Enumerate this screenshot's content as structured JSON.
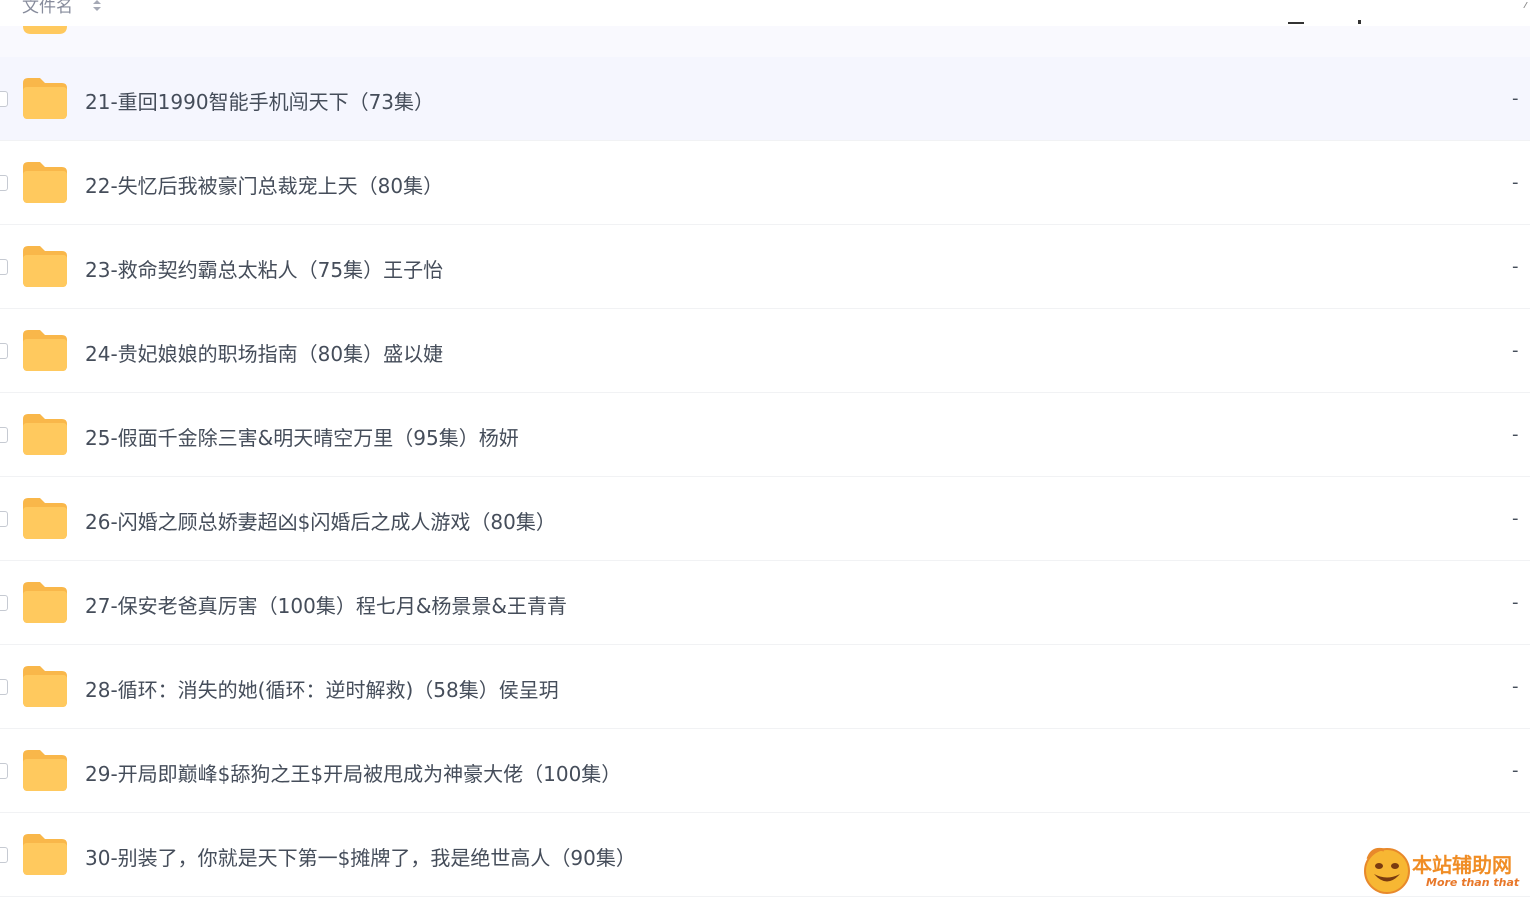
{
  "header": {
    "filename_label": "文件名"
  },
  "rows": [
    {
      "name": "",
      "size": ""
    },
    {
      "name": "21-重回1990智能手机闯天下（73集）",
      "size": "-"
    },
    {
      "name": "22-失忆后我被豪门总裁宠上天（80集）",
      "size": "-"
    },
    {
      "name": "23-救命契约霸总太粘人（75集）王子怡",
      "size": "-"
    },
    {
      "name": "24-贵妃娘娘的职场指南（80集）盛以婕",
      "size": "-"
    },
    {
      "name": "25-假面千金除三害&明天晴空万里（95集）杨妍",
      "size": "-"
    },
    {
      "name": "26-闪婚之顾总娇妻超凶$闪婚后之成人游戏（80集）",
      "size": "-"
    },
    {
      "name": "27-保安老爸真厉害（100集）程七月&杨景景&王青青",
      "size": "-"
    },
    {
      "name": "28-循环：消失的她(循环：逆时解救)（58集）侯呈玥",
      "size": "-"
    },
    {
      "name": "29-开局即巅峰$舔狗之王$开局被甩成为神豪大佬（100集）",
      "size": "-"
    },
    {
      "name": "30-别装了，你就是天下第一$摊牌了，我是绝世高人（90集）",
      "size": ""
    }
  ],
  "watermark": {
    "title": "本站辅助网",
    "subtitle": "More than that"
  },
  "colors": {
    "folder": "#ffc95e",
    "folder_back": "#f9b74a",
    "hover_row": "#f5f6fe",
    "text": "#454d5a"
  }
}
